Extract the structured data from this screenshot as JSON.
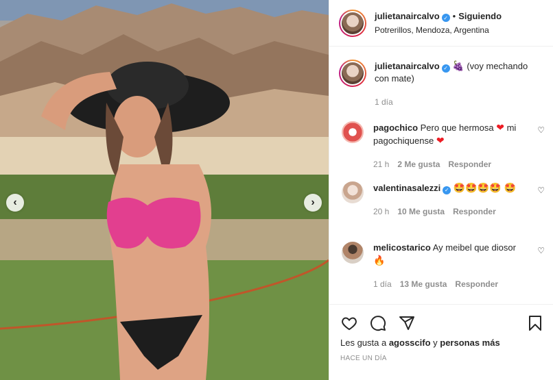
{
  "post": {
    "username": "julietanaircalvo",
    "separator": "•",
    "follow_state": "Siguiendo",
    "location": "Potrerillos, Mendoza, Argentina"
  },
  "photo": {
    "prev_icon": "chevron-left-icon",
    "next_icon": "chevron-right-icon"
  },
  "caption": {
    "username": "julietanaircalvo",
    "emoji": "🍇",
    "text": " (voy mechando con mate)",
    "time": "1 día"
  },
  "comments": [
    {
      "username": "pagochico",
      "text_before": "Pero que hermosa ",
      "emoji_1": "❤",
      "text_after": " mi pagochiquense ",
      "emoji_2": "❤",
      "time": "21 h",
      "likes": "2 Me gusta",
      "reply": "Responder"
    },
    {
      "username": "valentinasalezzi",
      "emojis": "🤩🤩🤩🤩 🤩",
      "time": "20 h",
      "likes": "10 Me gusta",
      "reply": "Responder"
    },
    {
      "username": "melicostarico",
      "text": "Ay meibel que diosor ",
      "emoji": "🔥",
      "time": "1 día",
      "likes": "13 Me gusta",
      "reply": "Responder"
    }
  ],
  "actions": {
    "like_icon": "heart-icon",
    "comment_icon": "comment-icon",
    "share_icon": "share-icon",
    "save_icon": "bookmark-icon"
  },
  "likes_line": {
    "prefix": "Les gusta a ",
    "user": "agosscifo",
    "middle": " y ",
    "others": "personas más"
  },
  "timestamp": "HACE UN DÍA",
  "colors": {
    "verified": "#3897f0",
    "muted": "#8e8e8e",
    "text": "#262626",
    "heart_red": "#ed1c24"
  }
}
